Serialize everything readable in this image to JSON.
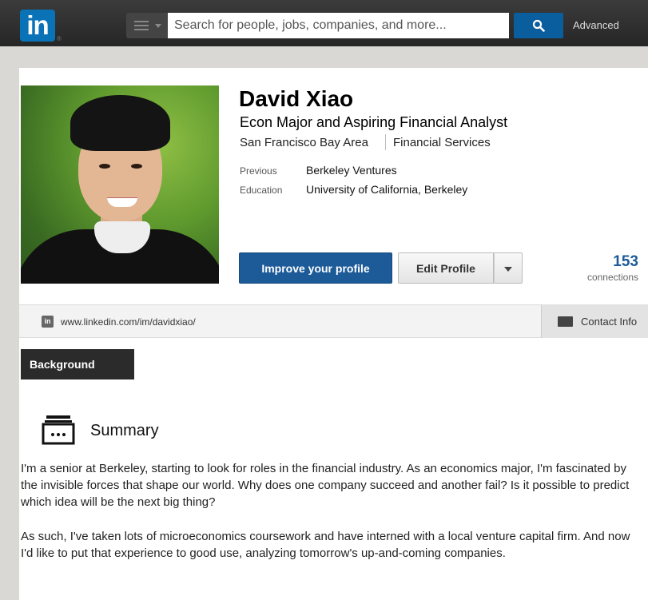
{
  "topbar": {
    "logo_text": "in",
    "search_placeholder": "Search for people, jobs, companies, and more...",
    "advanced_label": "Advanced"
  },
  "profile": {
    "name": "David Xiao",
    "headline": "Econ Major and Aspiring Financial Analyst",
    "location": "San Francisco Bay Area",
    "industry": "Financial Services",
    "previous_label": "Previous",
    "previous_value": "Berkeley Ventures",
    "education_label": "Education",
    "education_value": "University of California, Berkeley",
    "improve_button": "Improve your profile",
    "edit_button": "Edit Profile",
    "connections_count": "153",
    "connections_label": "connections"
  },
  "urlbar": {
    "icon_text": "in",
    "url": "www.linkedin.com/im/davidxiao/",
    "contact_label": "Contact Info"
  },
  "background": {
    "tab_label": "Background",
    "summary_title": "Summary",
    "paragraph1": "I'm a senior at Berkeley, starting to look for roles in the financial industry. As an economics major, I'm fascinated by the invisible forces that shape our world. Why does one company succeed and another fail? Is it possible to predict which idea will be the next big thing?",
    "paragraph2": "As such, I've taken lots of microeconomics coursework and have interned with a local venture capital firm. And now I'd like to put that experience to good use, analyzing tomorrow's up-and-coming companies."
  },
  "colors": {
    "brand_blue": "#0a73b8",
    "button_blue": "#1c5a98",
    "topbar_dark": "#2f2f2f"
  }
}
